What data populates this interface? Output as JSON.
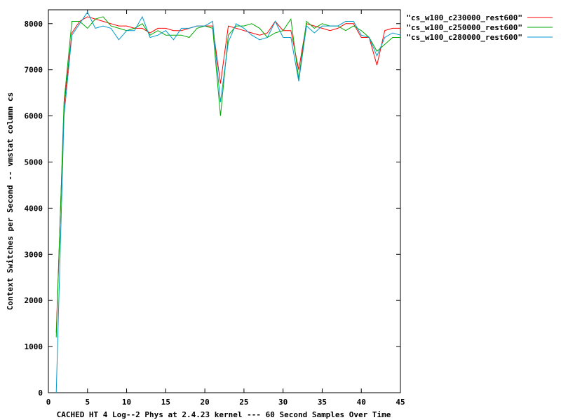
{
  "chart_data": {
    "type": "line",
    "title": "",
    "xlabel": "CACHED HT 4 Log--2 Phys at 2.4.23 kernel --- 60 Second Samples Over Time",
    "ylabel": "Context Switches per Second -- vmstat column cs",
    "xlim": [
      0,
      45
    ],
    "ylim": [
      0,
      8300
    ],
    "xticks": [
      0,
      5,
      10,
      15,
      20,
      25,
      30,
      35,
      40,
      45
    ],
    "yticks": [
      0,
      1000,
      2000,
      3000,
      4000,
      5000,
      6000,
      7000,
      8000
    ],
    "grid": false,
    "legend_position": "top-right",
    "series": [
      {
        "name": "\"cs_w100_c230000_rest600\"",
        "color": "#ff0000",
        "points": [
          [
            1,
            1300
          ],
          [
            2,
            6200
          ],
          [
            3,
            7800
          ],
          [
            4,
            8050
          ],
          [
            5,
            8150
          ],
          [
            6,
            8100
          ],
          [
            7,
            8050
          ],
          [
            8,
            8000
          ],
          [
            9,
            7950
          ],
          [
            10,
            7950
          ],
          [
            11,
            7900
          ],
          [
            12,
            7900
          ],
          [
            13,
            7800
          ],
          [
            14,
            7900
          ],
          [
            15,
            7900
          ],
          [
            16,
            7850
          ],
          [
            17,
            7850
          ],
          [
            18,
            7900
          ],
          [
            19,
            7950
          ],
          [
            20,
            7950
          ],
          [
            21,
            7950
          ],
          [
            22,
            6700
          ],
          [
            23,
            7950
          ],
          [
            24,
            7900
          ],
          [
            25,
            7850
          ],
          [
            26,
            7800
          ],
          [
            27,
            7750
          ],
          [
            28,
            7800
          ],
          [
            29,
            8050
          ],
          [
            30,
            7850
          ],
          [
            31,
            7850
          ],
          [
            32,
            7000
          ],
          [
            33,
            8000
          ],
          [
            34,
            7950
          ],
          [
            35,
            7900
          ],
          [
            36,
            7850
          ],
          [
            37,
            7900
          ],
          [
            38,
            8000
          ],
          [
            39,
            8000
          ],
          [
            40,
            7700
          ],
          [
            41,
            7700
          ],
          [
            42,
            7100
          ],
          [
            43,
            7850
          ],
          [
            44,
            7900
          ],
          [
            45,
            7900
          ]
        ]
      },
      {
        "name": "\"cs_w100_c250000_rest600\"",
        "color": "#00aa00",
        "points": [
          [
            1,
            1200
          ],
          [
            2,
            6300
          ],
          [
            3,
            8050
          ],
          [
            4,
            8050
          ],
          [
            5,
            7900
          ],
          [
            6,
            8100
          ],
          [
            7,
            8150
          ],
          [
            8,
            7950
          ],
          [
            9,
            7900
          ],
          [
            10,
            7850
          ],
          [
            11,
            7900
          ],
          [
            12,
            8000
          ],
          [
            13,
            7750
          ],
          [
            14,
            7850
          ],
          [
            15,
            7750
          ],
          [
            16,
            7750
          ],
          [
            17,
            7750
          ],
          [
            18,
            7700
          ],
          [
            19,
            7900
          ],
          [
            20,
            7950
          ],
          [
            21,
            7900
          ],
          [
            22,
            6000
          ],
          [
            23,
            7750
          ],
          [
            24,
            7950
          ],
          [
            25,
            7950
          ],
          [
            26,
            8000
          ],
          [
            27,
            7900
          ],
          [
            28,
            7700
          ],
          [
            29,
            7800
          ],
          [
            30,
            7850
          ],
          [
            31,
            8100
          ],
          [
            32,
            6800
          ],
          [
            33,
            8050
          ],
          [
            34,
            7900
          ],
          [
            35,
            8000
          ],
          [
            36,
            7950
          ],
          [
            37,
            7950
          ],
          [
            38,
            7850
          ],
          [
            39,
            7950
          ],
          [
            40,
            7850
          ],
          [
            41,
            7700
          ],
          [
            42,
            7400
          ],
          [
            43,
            7550
          ],
          [
            44,
            7700
          ],
          [
            45,
            7700
          ]
        ]
      },
      {
        "name": "\"cs_w100_c280000_rest600\"",
        "color": "#0099cc",
        "points": [
          [
            1,
            0
          ],
          [
            2,
            6000
          ],
          [
            3,
            7750
          ],
          [
            4,
            8000
          ],
          [
            5,
            8250
          ],
          [
            6,
            7900
          ],
          [
            7,
            7950
          ],
          [
            8,
            7900
          ],
          [
            9,
            7650
          ],
          [
            10,
            7850
          ],
          [
            11,
            7850
          ],
          [
            12,
            8150
          ],
          [
            13,
            7700
          ],
          [
            14,
            7750
          ],
          [
            15,
            7850
          ],
          [
            16,
            7650
          ],
          [
            17,
            7900
          ],
          [
            18,
            7900
          ],
          [
            19,
            7950
          ],
          [
            20,
            7950
          ],
          [
            21,
            8050
          ],
          [
            22,
            6300
          ],
          [
            23,
            7600
          ],
          [
            24,
            8000
          ],
          [
            25,
            7900
          ],
          [
            26,
            7750
          ],
          [
            27,
            7650
          ],
          [
            28,
            7700
          ],
          [
            29,
            8050
          ],
          [
            30,
            7700
          ],
          [
            31,
            7700
          ],
          [
            32,
            6750
          ],
          [
            33,
            7950
          ],
          [
            34,
            7800
          ],
          [
            35,
            7950
          ],
          [
            36,
            7950
          ],
          [
            37,
            7950
          ],
          [
            38,
            8050
          ],
          [
            39,
            8050
          ],
          [
            40,
            7750
          ],
          [
            41,
            7700
          ],
          [
            42,
            7300
          ],
          [
            43,
            7700
          ],
          [
            44,
            7800
          ],
          [
            45,
            7750
          ]
        ]
      }
    ]
  }
}
